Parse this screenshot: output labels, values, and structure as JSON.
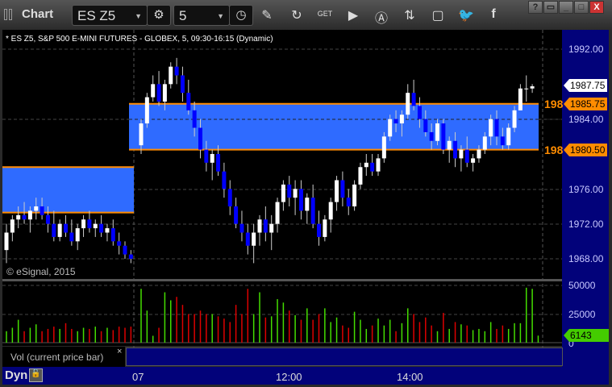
{
  "window": {
    "title": "Chart",
    "buttons": [
      "?",
      "▭",
      "_",
      "□",
      "X"
    ]
  },
  "toolbar": {
    "symbol": "ES Z5",
    "interval": "5",
    "icons": [
      "settings-gear-icon",
      "clock-icon",
      "pencil-icon",
      "study-icon",
      "get-icon",
      "play-icon",
      "alert-icon",
      "link-icon",
      "comment-icon",
      "twitter-icon",
      "facebook-icon"
    ]
  },
  "chart": {
    "symbol_line": "* ES Z5, S&P 500 E-MINI FUTURES - GLOBEX, 5, 09:30-16:15 (Dynamic)",
    "copyright": "© eSignal, 2015",
    "price_labels": [
      "1992.00",
      "1984.00",
      "1976.00",
      "1972.00",
      "1968.00"
    ],
    "last_price": "1987.75",
    "level_upper": "1985.75",
    "level_lower": "1980.50",
    "level_prefix": "198",
    "volume_labels": [
      "50000",
      "25000",
      "0"
    ],
    "last_volume": "6143",
    "volume_study": "Vol (current price bar)",
    "close_study": "×",
    "time_labels": [
      "07",
      "12:00",
      "14:00"
    ],
    "mode": "Dyn",
    "colors": {
      "band": "#2f6bff",
      "band_edge": "#ff8c00",
      "up": "#ffffff",
      "down": "#0000ff",
      "vol_up": "#44dd00",
      "vol_down": "#dd0000",
      "axis": "#02027a"
    }
  },
  "chart_data": {
    "type": "candlestick",
    "ylim": [
      1967,
      1993
    ],
    "bands": [
      {
        "high": 1978.5,
        "low": 1973.3,
        "session": 1
      },
      {
        "high": 1985.75,
        "low": 1980.5,
        "session": 2
      }
    ],
    "session1": [
      [
        1969,
        1972,
        1967.5,
        1971
      ],
      [
        1971,
        1973,
        1970,
        1972.5
      ],
      [
        1972.5,
        1974,
        1971.5,
        1973
      ],
      [
        1973,
        1974.5,
        1972,
        1972.5
      ],
      [
        1972.5,
        1974,
        1971,
        1973.5
      ],
      [
        1973.5,
        1975,
        1972.5,
        1974
      ],
      [
        1974,
        1975,
        1972.5,
        1973
      ],
      [
        1973,
        1974,
        1971,
        1972
      ],
      [
        1972,
        1973.5,
        1970,
        1970.5
      ],
      [
        1970.5,
        1972.5,
        1970,
        1972
      ],
      [
        1972,
        1973,
        1970.5,
        1971
      ],
      [
        1971,
        1972.5,
        1969.5,
        1970
      ],
      [
        1970,
        1972,
        1969,
        1971.5
      ],
      [
        1971.5,
        1973,
        1970.5,
        1972.5
      ],
      [
        1972.5,
        1973.5,
        1971,
        1971.5
      ],
      [
        1971.5,
        1972.5,
        1970.5,
        1972
      ],
      [
        1972,
        1973,
        1970.5,
        1971
      ],
      [
        1971,
        1972,
        1970,
        1971.5
      ],
      [
        1971.5,
        1972.5,
        1969.5,
        1970
      ],
      [
        1970,
        1971,
        1968.5,
        1969.5
      ],
      [
        1969.5,
        1970,
        1968,
        1968.5
      ],
      [
        1968.5,
        1969,
        1967.5,
        1968
      ]
    ],
    "session2": [
      [
        1981,
        1984,
        1980,
        1983.5
      ],
      [
        1983.5,
        1987,
        1983,
        1986.5
      ],
      [
        1986.5,
        1989,
        1986,
        1988
      ],
      [
        1988,
        1989.5,
        1985.5,
        1986
      ],
      [
        1986,
        1988.5,
        1985,
        1988
      ],
      [
        1988,
        1990.5,
        1987.5,
        1990
      ],
      [
        1990,
        1991,
        1988,
        1989
      ],
      [
        1989,
        1990,
        1986,
        1987
      ],
      [
        1987,
        1988.5,
        1984.5,
        1985
      ],
      [
        1985,
        1986,
        1982,
        1983
      ],
      [
        1983,
        1984,
        1979.5,
        1980.5
      ],
      [
        1980.5,
        1981.5,
        1978,
        1979
      ],
      [
        1979,
        1980.5,
        1977,
        1980
      ],
      [
        1980,
        1981,
        1977.5,
        1978
      ],
      [
        1978,
        1979,
        1975,
        1976
      ],
      [
        1976,
        1977,
        1973,
        1974
      ],
      [
        1974,
        1975,
        1971.5,
        1972
      ],
      [
        1972,
        1973.5,
        1970,
        1971
      ],
      [
        1971,
        1972,
        1968.5,
        1969.5
      ],
      [
        1969.5,
        1972,
        1967.5,
        1971
      ],
      [
        1971,
        1973,
        1969.5,
        1972.5
      ],
      [
        1972.5,
        1974,
        1970,
        1971
      ],
      [
        1971,
        1973,
        1969,
        1972
      ],
      [
        1972,
        1975,
        1971,
        1974.5
      ],
      [
        1974.5,
        1977,
        1973.5,
        1976.5
      ],
      [
        1976.5,
        1977.5,
        1974,
        1975
      ],
      [
        1975,
        1977,
        1973,
        1976
      ],
      [
        1976,
        1977,
        1972.5,
        1973.5
      ],
      [
        1973.5,
        1975.5,
        1972,
        1975
      ],
      [
        1975,
        1976.5,
        1971.5,
        1972
      ],
      [
        1972,
        1973.5,
        1969.5,
        1970.5
      ],
      [
        1970.5,
        1973,
        1970,
        1972.5
      ],
      [
        1972.5,
        1975,
        1971,
        1974.5
      ],
      [
        1974.5,
        1977.5,
        1973.5,
        1977
      ],
      [
        1977,
        1978,
        1974,
        1975
      ],
      [
        1975,
        1976,
        1973,
        1974
      ],
      [
        1974,
        1977,
        1973.5,
        1976.5
      ],
      [
        1976.5,
        1979,
        1976,
        1978.5
      ],
      [
        1978.5,
        1980,
        1977.5,
        1979
      ],
      [
        1979,
        1980,
        1977.5,
        1978
      ],
      [
        1978,
        1980,
        1977.5,
        1979.5
      ],
      [
        1979.5,
        1982.5,
        1979,
        1982
      ],
      [
        1982,
        1984.5,
        1981.5,
        1984
      ],
      [
        1984,
        1985,
        1982.5,
        1983.5
      ],
      [
        1983.5,
        1985,
        1982,
        1984.5
      ],
      [
        1984.5,
        1988,
        1984,
        1987
      ],
      [
        1987,
        1988.5,
        1985,
        1985.5
      ],
      [
        1985.5,
        1986.5,
        1983,
        1984
      ],
      [
        1984,
        1985,
        1982,
        1982.5
      ],
      [
        1982.5,
        1983.5,
        1980.5,
        1981.5
      ],
      [
        1981.5,
        1984,
        1981,
        1983.5
      ],
      [
        1983.5,
        1984,
        1980,
        1980.5
      ],
      [
        1980.5,
        1982,
        1979,
        1981.5
      ],
      [
        1981.5,
        1982.5,
        1978.5,
        1979.5
      ],
      [
        1979.5,
        1981,
        1978,
        1980.5
      ],
      [
        1980.5,
        1982,
        1978.5,
        1979
      ],
      [
        1979,
        1980,
        1978,
        1979.5
      ],
      [
        1979.5,
        1981,
        1979,
        1980.5
      ],
      [
        1980.5,
        1982.5,
        1980,
        1982
      ],
      [
        1982,
        1984.5,
        1981,
        1984
      ],
      [
        1984,
        1985,
        1981,
        1982
      ],
      [
        1982,
        1983,
        1980.5,
        1981
      ],
      [
        1981,
        1983.5,
        1980.5,
        1983
      ],
      [
        1983,
        1985.5,
        1982.5,
        1985
      ],
      [
        1985,
        1988,
        1985,
        1987.5
      ],
      [
        1987.5,
        1989,
        1986,
        1987.5
      ],
      [
        1987.5,
        1988,
        1987,
        1987.75
      ]
    ],
    "volume1": [
      10000,
      13000,
      20000,
      10000,
      13000,
      16000,
      10000,
      12000,
      14000,
      12000,
      17000,
      12000,
      10000,
      13000,
      12000,
      14000,
      10000,
      13000,
      11000,
      14000,
      13000,
      14000
    ],
    "volume2": [
      47000,
      28000,
      6000,
      13000,
      44000,
      37000,
      40000,
      33000,
      25000,
      25000,
      28000,
      25000,
      25000,
      23000,
      21000,
      18000,
      33000,
      25000,
      47000,
      25000,
      44000,
      22000,
      23000,
      38000,
      35000,
      28000,
      24000,
      20000,
      30000,
      20000,
      25000,
      30000,
      18000,
      22000,
      15000,
      13000,
      27000,
      20000,
      12000,
      15000,
      21000,
      15000,
      20000,
      10000,
      17000,
      30000,
      25000,
      18000,
      22000,
      15000,
      10000,
      26000,
      12000,
      18000,
      16000,
      15000,
      11000,
      12000,
      10000,
      18000,
      12000,
      15000,
      12000,
      17000,
      17000,
      48000,
      47000,
      6143
    ]
  }
}
